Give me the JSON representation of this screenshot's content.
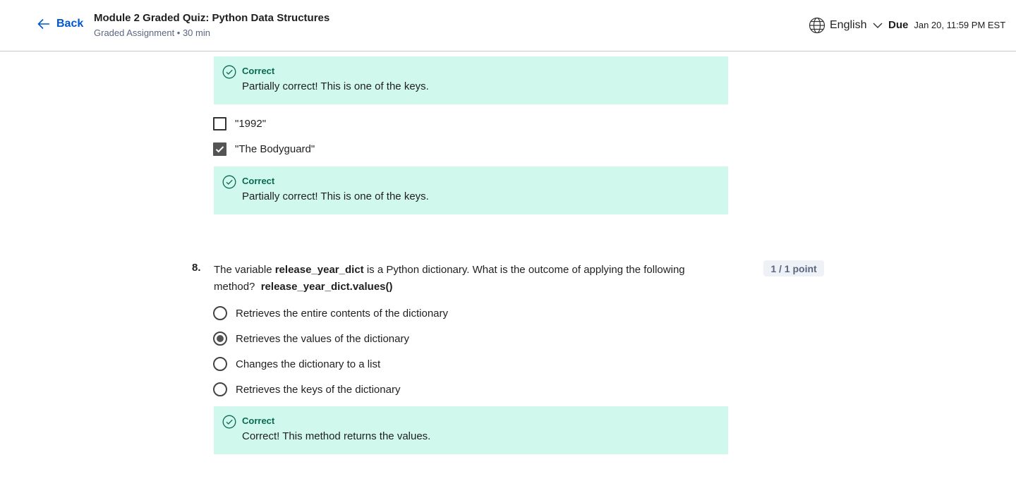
{
  "header": {
    "back_label": "Back",
    "title": "Module 2 Graded Quiz: Python Data Structures",
    "subtitle": "Graded Assignment • 30 min",
    "language": "English",
    "due_label": "Due",
    "due_date": "Jan 20, 11:59 PM EST"
  },
  "colors": {
    "accent": "#0056d2",
    "feedback_bg": "#d1f8ec",
    "correct_text": "#076b51"
  },
  "feedback_top": {
    "title": "Correct",
    "text": "Partially correct! This is one of the keys."
  },
  "q7_options": [
    {
      "label": "\"1992\"",
      "checked": false
    },
    {
      "label": "\"The Bodyguard\"",
      "checked": true
    }
  ],
  "feedback_mid": {
    "title": "Correct",
    "text": "Partially correct! This is one of the keys."
  },
  "q8": {
    "number": "8.",
    "text_pre": "The variable ",
    "text_var": "release_year_dict",
    "text_mid": " is a Python dictionary. What is the outcome of applying the following method? ",
    "text_code": "release_year_dict.values()",
    "points": "1 / 1 point",
    "options": [
      {
        "label": "Retrieves the entire contents of the dictionary",
        "selected": false
      },
      {
        "label": "Retrieves the values of the dictionary",
        "selected": true
      },
      {
        "label": "Changes the dictionary to a list",
        "selected": false
      },
      {
        "label": "Retrieves the keys of the dictionary",
        "selected": false
      }
    ],
    "feedback": {
      "title": "Correct",
      "text": "Correct! This method returns the values."
    }
  }
}
